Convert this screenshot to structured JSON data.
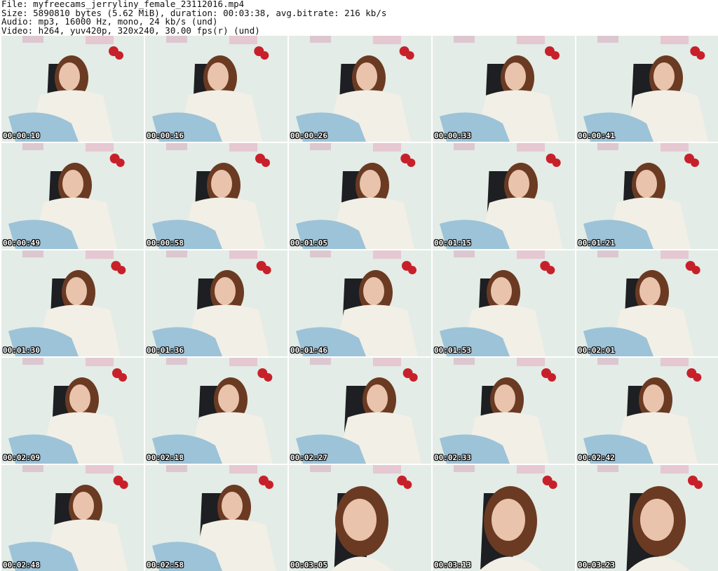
{
  "header": {
    "file": "File: myfreecams_jerryliny_female_23112016.mp4",
    "size": "Size: 5890810 bytes (5.62 MiB), duration: 00:03:38, avg.bitrate: 216 kb/s",
    "audio": "Audio: mp3, 16000 Hz, mono, 24 kb/s (und)",
    "video": "Video: h264, yuv420p, 320x240, 30.00 fps(r) (und)"
  },
  "thumbnails": [
    {
      "time": "00:00:10"
    },
    {
      "time": "00:00:16"
    },
    {
      "time": "00:00:26"
    },
    {
      "time": "00:00:33"
    },
    {
      "time": "00:00:41"
    },
    {
      "time": "00:00:49"
    },
    {
      "time": "00:00:58"
    },
    {
      "time": "00:01:05"
    },
    {
      "time": "00:01:15"
    },
    {
      "time": "00:01:21"
    },
    {
      "time": "00:01:30"
    },
    {
      "time": "00:01:36"
    },
    {
      "time": "00:01:46"
    },
    {
      "time": "00:01:53"
    },
    {
      "time": "00:02:01"
    },
    {
      "time": "00:02:09"
    },
    {
      "time": "00:02:18"
    },
    {
      "time": "00:02:27"
    },
    {
      "time": "00:02:33"
    },
    {
      "time": "00:02:42"
    },
    {
      "time": "00:02:48"
    },
    {
      "time": "00:02:58"
    },
    {
      "time": "00:03:05"
    },
    {
      "time": "00:03:13"
    },
    {
      "time": "00:03:23"
    }
  ],
  "colors": {
    "background_wall": "#e3ece6",
    "sweater": "#f2efe6",
    "hair": "#6b3a22",
    "jeans": "#9cc3d8",
    "chair": "#1d1f22",
    "flowers": "#c8202a"
  }
}
